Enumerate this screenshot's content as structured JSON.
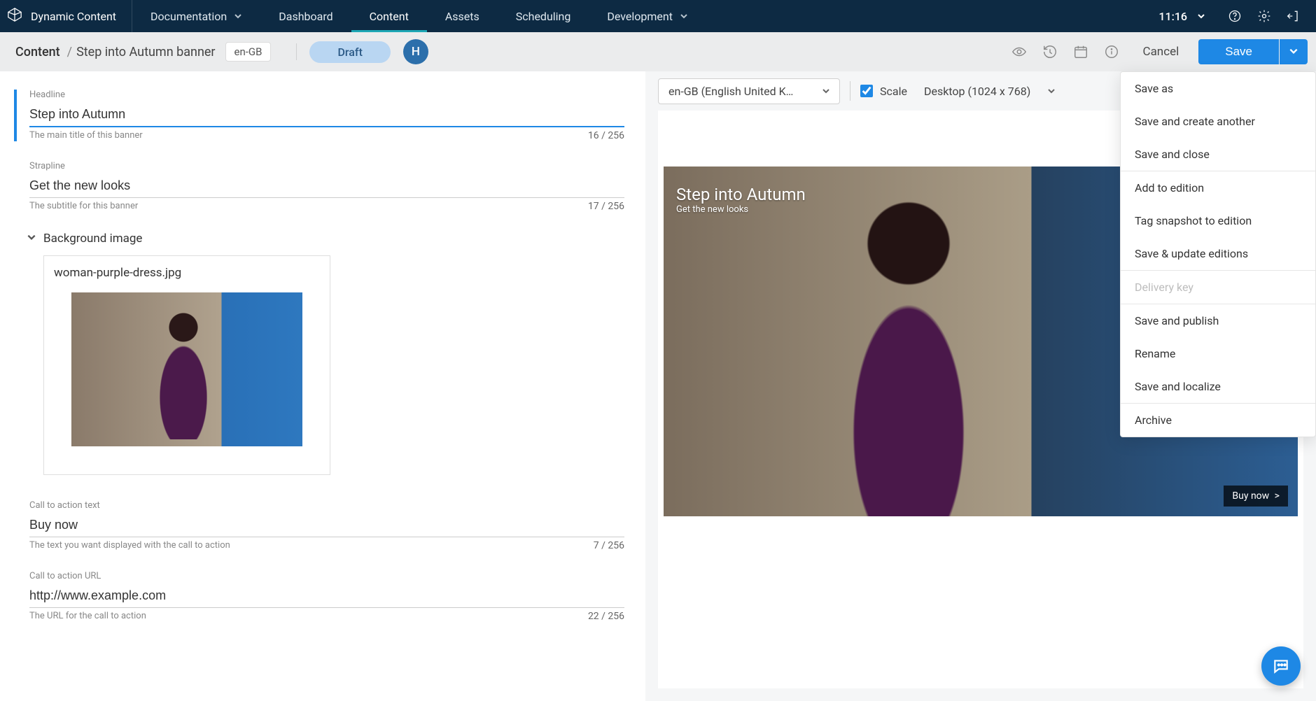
{
  "brand": {
    "name": "Dynamic Content"
  },
  "topnav": [
    {
      "label": "Documentation",
      "has_dropdown": true
    },
    {
      "label": "Dashboard"
    },
    {
      "label": "Content",
      "active": true
    },
    {
      "label": "Assets"
    },
    {
      "label": "Scheduling"
    },
    {
      "label": "Development",
      "has_dropdown": true
    }
  ],
  "clock": {
    "time": "11:16"
  },
  "breadcrumb": {
    "root": "Content",
    "leaf": "Step into Autumn banner"
  },
  "locale_chip": "en-GB",
  "status_chip": "Draft",
  "avatar_initial": "H",
  "actions": {
    "cancel": "Cancel",
    "save": "Save"
  },
  "save_menu": {
    "save_as": "Save as",
    "save_create_another": "Save and create another",
    "save_close": "Save and close",
    "add_to_edition": "Add to edition",
    "tag_snapshot": "Tag snapshot to edition",
    "save_update_editions": "Save & update editions",
    "delivery_key": "Delivery key",
    "save_publish": "Save and publish",
    "rename": "Rename",
    "save_localize": "Save and localize",
    "archive": "Archive"
  },
  "form": {
    "headline": {
      "label": "Headline",
      "value": "Step into Autumn",
      "helper": "The main title of this banner",
      "counter": "16 / 256"
    },
    "strapline": {
      "label": "Strapline",
      "value": "Get the new looks",
      "helper": "The subtitle for this banner",
      "counter": "17 / 256"
    },
    "background": {
      "section_label": "Background image",
      "filename": "woman-purple-dress.jpg"
    },
    "cta_text": {
      "label": "Call to action text",
      "value": "Buy now",
      "helper": "The text you want displayed with the call to action",
      "counter": "7 / 256"
    },
    "cta_url": {
      "label": "Call to action URL",
      "value": "http://www.example.com",
      "helper": "The URL for the call to action",
      "counter": "22 / 256"
    }
  },
  "preview": {
    "language": "en-GB (English United Kin...",
    "scale_label": "Scale",
    "scale_checked": true,
    "device": "Desktop (1024 x 768)",
    "banner": {
      "headline": "Step into Autumn",
      "strapline": "Get the new looks",
      "cta": "Buy now",
      "cta_arrow": ">"
    }
  }
}
